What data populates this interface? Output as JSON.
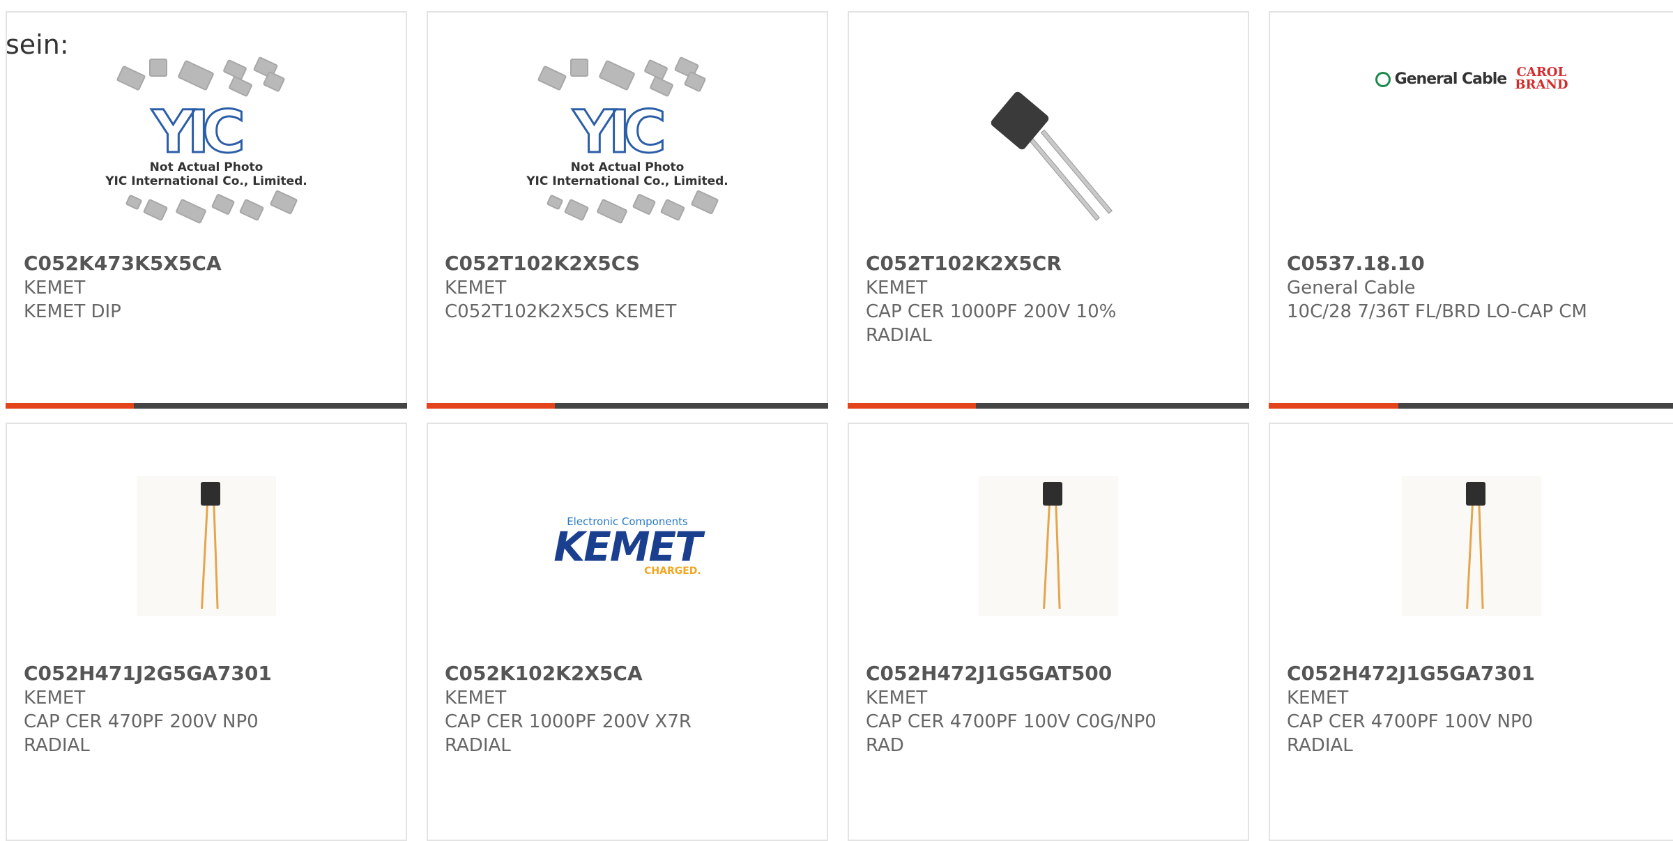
{
  "leading_text": "sein:",
  "cards": [
    {
      "part": "C052K473K5X5CA",
      "maker": "KEMET",
      "desc": "KEMET DIP",
      "thumb": "yic-not-actual-photo"
    },
    {
      "part": "C052T102K2X5CS",
      "maker": "KEMET",
      "desc": "C052T102K2X5CS KEMET",
      "thumb": "yic-not-actual-photo"
    },
    {
      "part": "C052T102K2X5CR",
      "maker": "KEMET",
      "desc": "CAP CER 1000PF 200V 10%\nRADIAL",
      "thumb": "capacitor-photo"
    },
    {
      "part": "C0537.18.10",
      "maker": "General Cable",
      "desc": "10C/28 7/36T FL/BRD LO-CAP CM",
      "thumb": "general-cable-logo"
    },
    {
      "part": "C052H471J2G5GA7301",
      "maker": "KEMET",
      "desc": "CAP CER 470PF 200V NP0\nRADIAL",
      "thumb": "radial-capacitor-photo"
    },
    {
      "part": "C052K102K2X5CA",
      "maker": "KEMET",
      "desc": "CAP CER 1000PF 200V X7R\nRADIAL",
      "thumb": "kemet-logo"
    },
    {
      "part": "C052H472J1G5GAT500",
      "maker": "KEMET",
      "desc": "CAP CER 4700PF 100V C0G/NP0\nRAD",
      "thumb": "radial-capacitor-photo"
    },
    {
      "part": "C052H472J1G5GA7301",
      "maker": "KEMET",
      "desc": "CAP CER 4700PF 100V NP0\nRADIAL",
      "thumb": "radial-capacitor-photo"
    }
  ],
  "yic_caption_1": "Not Actual Photo",
  "yic_caption_2": "YIC International Co., Limited.",
  "yic_logo_text": "YIC",
  "gc_logo_text": "General Cable",
  "carol_brand_text_1": "CAROL",
  "carol_brand_text_2": "BRAND",
  "kemet_logo_top": "Electronic Components",
  "kemet_logo_main": "KEMET",
  "kemet_logo_sub": "CHARGED.",
  "colors": {
    "accent_bar": "#e3441c",
    "bar": "#444444",
    "border": "#e3e3e3",
    "text": "#666666"
  }
}
